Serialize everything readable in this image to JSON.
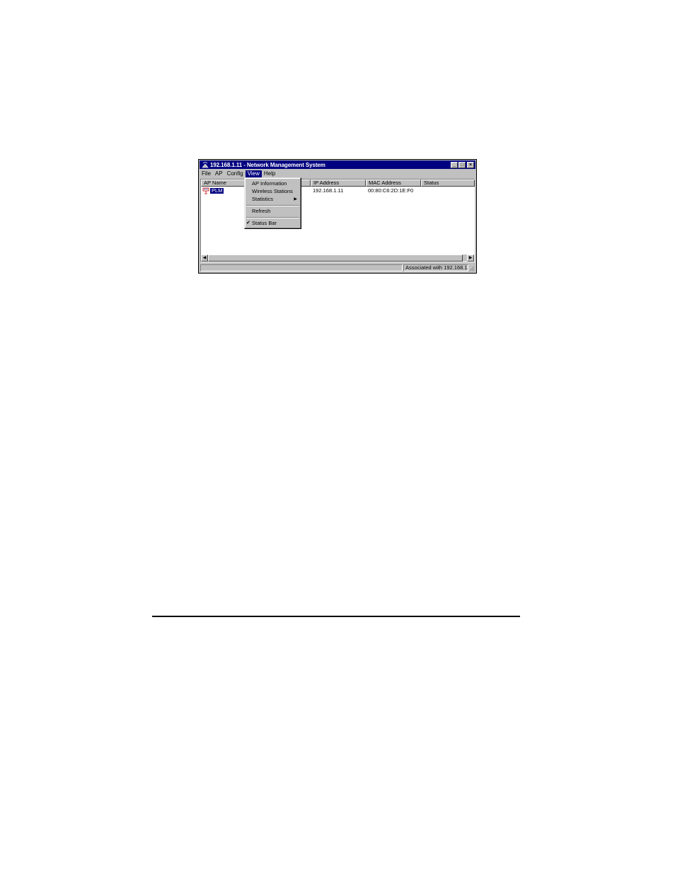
{
  "window": {
    "title": "192.168.1.11 - Network Management System",
    "controls": {
      "minimize": "_",
      "maximize": "□",
      "close": "×"
    }
  },
  "menubar": {
    "items": [
      "File",
      "AP",
      "Config",
      "View",
      "Help"
    ],
    "active": "View"
  },
  "view_menu": {
    "items": {
      "ap_information": "AP Information",
      "wireless_stations": "Wireless Stations",
      "statistics": "Statistics",
      "refresh": "Refresh",
      "status_bar": "Status Bar"
    },
    "status_bar_checked": true,
    "check_glyph": "✔",
    "submenu_glyph": "▶"
  },
  "list": {
    "columns": [
      "AP Name",
      "IP Address",
      "MAC Address",
      "Status"
    ],
    "rows": [
      {
        "ap_name": "PLM",
        "ip_address": "192.168.1.11",
        "mac_address": "00:80:C6:2D:1E:F0",
        "status": ""
      }
    ]
  },
  "scrollbar": {
    "left_glyph": "◀",
    "right_glyph": "▶"
  },
  "statusbar": {
    "text": "Associated with 192.168.1."
  },
  "colors": {
    "title_bg": "#000080",
    "face": "#c0c0c0",
    "highlight": "#000080"
  }
}
